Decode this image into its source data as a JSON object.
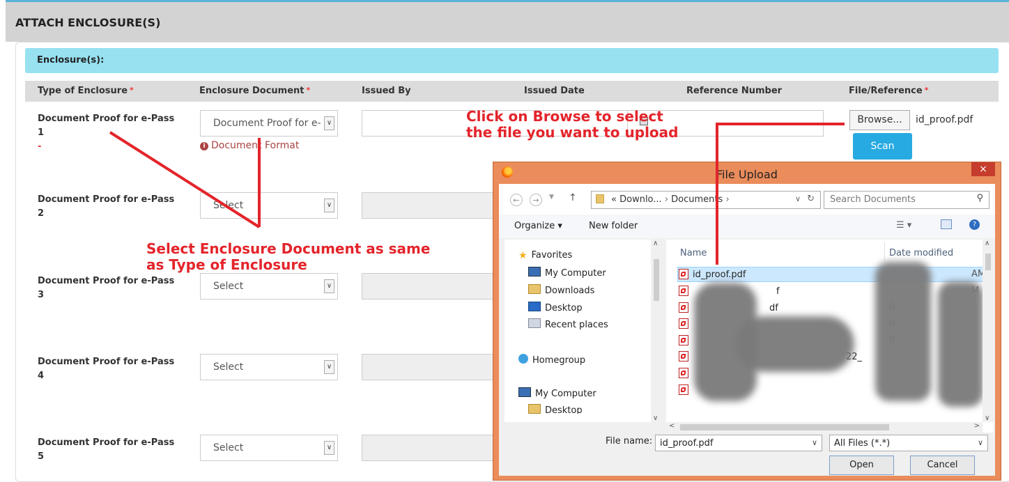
{
  "page": {
    "title": "ATTACH ENCLOSURE(S)",
    "section_title": "Enclosure(s):"
  },
  "table": {
    "headers": [
      "Type of Enclosure",
      "Enclosure Document",
      "Issued By",
      "Issued Date",
      "Reference Number",
      "File/Reference"
    ],
    "required_mark": "*",
    "rows": [
      {
        "type": "Document Proof for e-Pass",
        "num": "1",
        "doc": "Document Proof for e-F",
        "extra_mark": "-"
      },
      {
        "type": "Document Proof for e-Pass",
        "num": "2",
        "doc": "Select"
      },
      {
        "type": "Document Proof for e-Pass",
        "num": "3",
        "doc": "Select"
      },
      {
        "type": "Document Proof for e-Pass",
        "num": "4",
        "doc": "Select"
      },
      {
        "type": "Document Proof for e-Pass",
        "num": "5",
        "doc": "Select"
      }
    ],
    "doc_format_link": "Document Format",
    "browse_label": "Browse...",
    "selected_file": "id_proof.pdf",
    "scan_label": "Scan"
  },
  "annotations": {
    "browse_hint": [
      "Click on Browse to select",
      "the file you want to upload"
    ],
    "enclosure_hint": [
      "Select Enclosure Document as same",
      "as Type of Enclosure"
    ],
    "color": "#e3242b"
  },
  "dialog": {
    "title": "File Upload",
    "close": "×",
    "address": {
      "prefix": "«",
      "crumbs": [
        "Downlo...",
        "Documents"
      ],
      "sep": "›"
    },
    "search_placeholder": "Search Documents",
    "toolbar": {
      "organize": "Organize ▾",
      "new_folder": "New folder"
    },
    "tree": [
      {
        "label": "Favorites",
        "icon": "star-icon"
      },
      {
        "label": "My Computer",
        "icon": "computer-icon"
      },
      {
        "label": "Downloads",
        "icon": "downloads-icon"
      },
      {
        "label": "Desktop",
        "icon": "desktop-icon"
      },
      {
        "label": "Recent places",
        "icon": "recent-icon"
      },
      {
        "label": "Homegroup",
        "icon": "homegroup-icon"
      },
      {
        "label": "My Computer",
        "icon": "computer-icon"
      },
      {
        "label": "Desktop",
        "icon": "desktop-icon"
      }
    ],
    "columns": [
      "Name",
      "Date modified"
    ],
    "files": [
      {
        "name": "id_proof.pdf",
        "date": "AM"
      },
      {
        "name": "f",
        "date": "M"
      },
      {
        "name": "df",
        "date": "0"
      },
      {
        "name": "",
        "date": "0"
      },
      {
        "name": "",
        "date": "0"
      },
      {
        "name": "22_",
        "date": ""
      },
      {
        "name": "",
        "date": ""
      },
      {
        "name": "",
        "date": ""
      }
    ],
    "file_name_label": "File name:",
    "file_name_value": "id_proof.pdf",
    "filter": "All Files (*.*)",
    "open": "Open",
    "cancel": "Cancel"
  }
}
